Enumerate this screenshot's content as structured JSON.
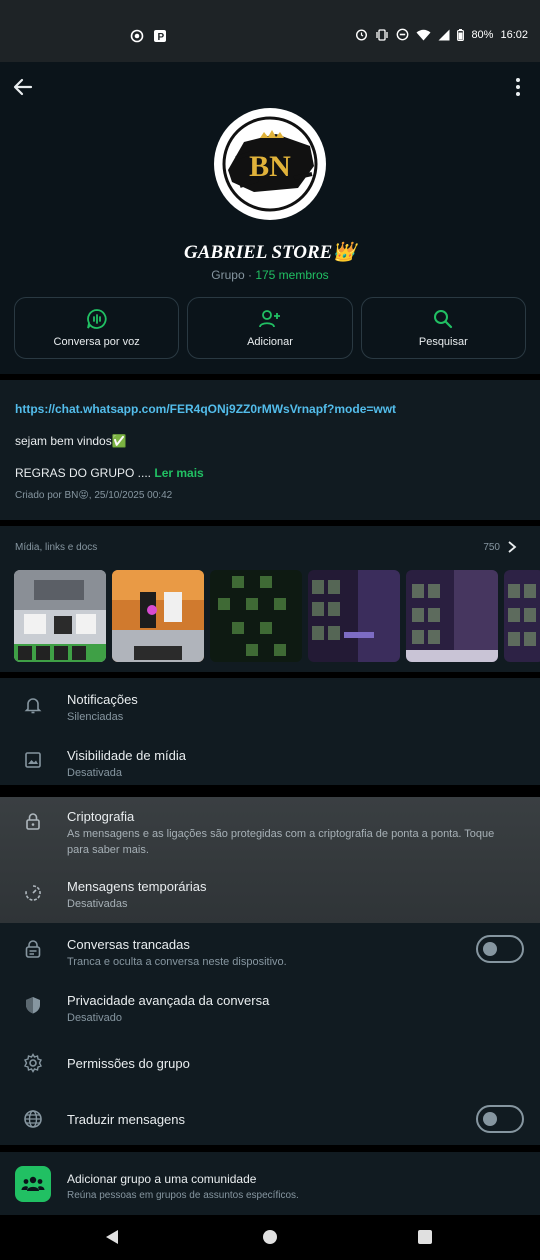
{
  "status_bar": {
    "battery": "80%",
    "time": "16:02"
  },
  "group": {
    "name": "GABRIEL STORE👑",
    "type": "Grupo · ",
    "members": "175 membros",
    "logo_text": "BN"
  },
  "actions": [
    {
      "label": "Conversa por voz",
      "icon": "voice-chat-icon"
    },
    {
      "label": "Adicionar",
      "icon": "add-person-icon"
    },
    {
      "label": "Pesquisar",
      "icon": "search-icon"
    }
  ],
  "description": {
    "link": "https://chat.whatsapp.com/FER4qONj9ZZ0rMWsVrnapf?mode=wwt",
    "welcome": "sejam bem vindos✅",
    "rules": "REGRAS DO GRUPO .... ",
    "read_more": "Ler mais",
    "created": "Criado por BN😝, 25/10/2025 00:42"
  },
  "media": {
    "title": "Mídia, links e docs",
    "count": "750"
  },
  "settings": {
    "notifications": {
      "title": "Notificações",
      "subtitle": "Silenciadas"
    },
    "media_visibility": {
      "title": "Visibilidade de mídia",
      "subtitle": "Desativada"
    },
    "encryption": {
      "title": "Criptografia",
      "subtitle": "As mensagens e as ligações são protegidas com a criptografia de ponta a ponta. Toque para saber mais."
    },
    "disappearing": {
      "title": "Mensagens temporárias",
      "subtitle": "Desativadas"
    },
    "locked": {
      "title": "Conversas trancadas",
      "subtitle": "Tranca e oculta a conversa neste dispositivo."
    },
    "privacy": {
      "title": "Privacidade avançada da conversa",
      "subtitle": "Desativado"
    },
    "permissions": {
      "title": "Permissões do grupo"
    },
    "translate": {
      "title": "Traduzir mensagens"
    }
  },
  "community": {
    "title": "Adicionar grupo a uma comunidade",
    "subtitle": "Reúna pessoas em grupos de assuntos específicos."
  },
  "colors": {
    "accent": "#21c063",
    "link": "#53bdeb",
    "background": "#0b141a",
    "panel": "#111b21"
  }
}
